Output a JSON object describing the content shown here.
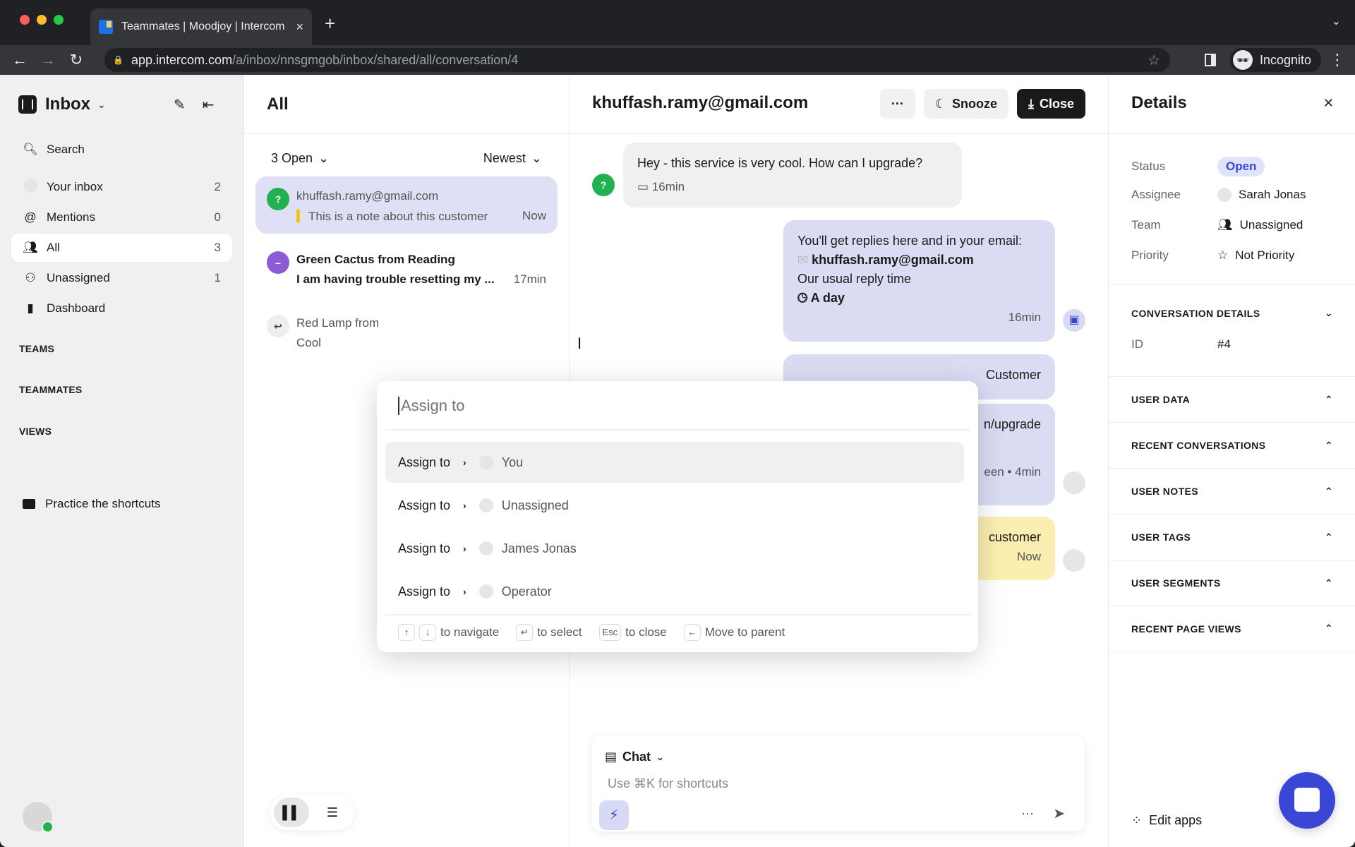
{
  "browser": {
    "tab_title": "Teammates | Moodjoy | Intercom",
    "new_tab": "+",
    "url_host": "app.intercom.com",
    "url_path": "/a/inbox/nnsgmgob/inbox/shared/all/conversation/4",
    "incognito_label": "Incognito"
  },
  "sidebar": {
    "app_name": "Inbox",
    "search_label": "Search",
    "items": [
      {
        "label": "Your inbox",
        "count": "2",
        "icon": "avatar-icon"
      },
      {
        "label": "Mentions",
        "count": "0",
        "icon": "at-icon"
      },
      {
        "label": "All",
        "count": "3",
        "icon": "people-icon",
        "active": true
      },
      {
        "label": "Unassigned",
        "count": "1",
        "icon": "unassigned-icon"
      },
      {
        "label": "Dashboard",
        "count": "",
        "icon": "bar-chart-icon"
      }
    ],
    "sections": [
      "TEAMS",
      "TEAMMATES",
      "VIEWS"
    ],
    "practice_label": "Practice the shortcuts"
  },
  "list": {
    "title": "All",
    "status_filter": "3 Open",
    "sort": "Newest",
    "conversations": [
      {
        "name": "khuffash.ramy@gmail.com",
        "preview": "This is a note about this customer",
        "time": "Now",
        "avatar": "?",
        "selected": true
      },
      {
        "name": "Green Cactus from Reading",
        "preview": "I am having trouble resetting my ...",
        "time": "17min",
        "avatar": "–"
      },
      {
        "name": "Red Lamp from",
        "preview": "Cool",
        "time": ""
      }
    ]
  },
  "conversation": {
    "title": "khuffash.ramy@gmail.com",
    "more_label": "···",
    "snooze_label": "Snooze",
    "close_label": "Close",
    "messages": {
      "incoming": {
        "text": "Hey - this service is very cool. How can I upgrade?",
        "time": "16min"
      },
      "auto_reply": {
        "line1": "You'll get replies here and in your email:",
        "email": "khuffash.ramy@gmail.com",
        "line3": "Our usual reply time",
        "line4": "A day",
        "time": "16min"
      },
      "partial1": "Customer",
      "partial2": "n/upgrade",
      "partial2_meta": "een • 4min",
      "note": {
        "text": "customer",
        "time": "Now"
      }
    },
    "composer": {
      "type": "Chat",
      "placeholder": "Use ⌘K for shortcuts"
    }
  },
  "details": {
    "title": "Details",
    "props": [
      {
        "key": "Status",
        "value": "Open"
      },
      {
        "key": "Assignee",
        "value": "Sarah Jonas"
      },
      {
        "key": "Team",
        "value": "Unassigned"
      },
      {
        "key": "Priority",
        "value": "Not Priority"
      }
    ],
    "conv_details": {
      "label": "CONVERSATION DETAILS",
      "id_key": "ID",
      "id_value": "#4"
    },
    "sections": [
      "USER DATA",
      "RECENT CONVERSATIONS",
      "USER NOTES",
      "USER TAGS",
      "USER SEGMENTS",
      "RECENT PAGE VIEWS"
    ],
    "edit_apps": "Edit apps"
  },
  "assign_menu": {
    "placeholder": "Assign to",
    "items": [
      {
        "action": "Assign to",
        "target": "You"
      },
      {
        "action": "Assign to",
        "target": "Unassigned"
      },
      {
        "action": "Assign to",
        "target": "James Jonas"
      },
      {
        "action": "Assign to",
        "target": "Operator"
      }
    ],
    "footer": {
      "navigate": "to navigate",
      "select": "to select",
      "esc_key": "Esc",
      "close": "to close",
      "parent": "Move to parent"
    }
  },
  "colors": {
    "accent": "#3946d6",
    "selected_row": "#dfe0f5",
    "note": "#faeeb0",
    "online": "#23b14d"
  }
}
